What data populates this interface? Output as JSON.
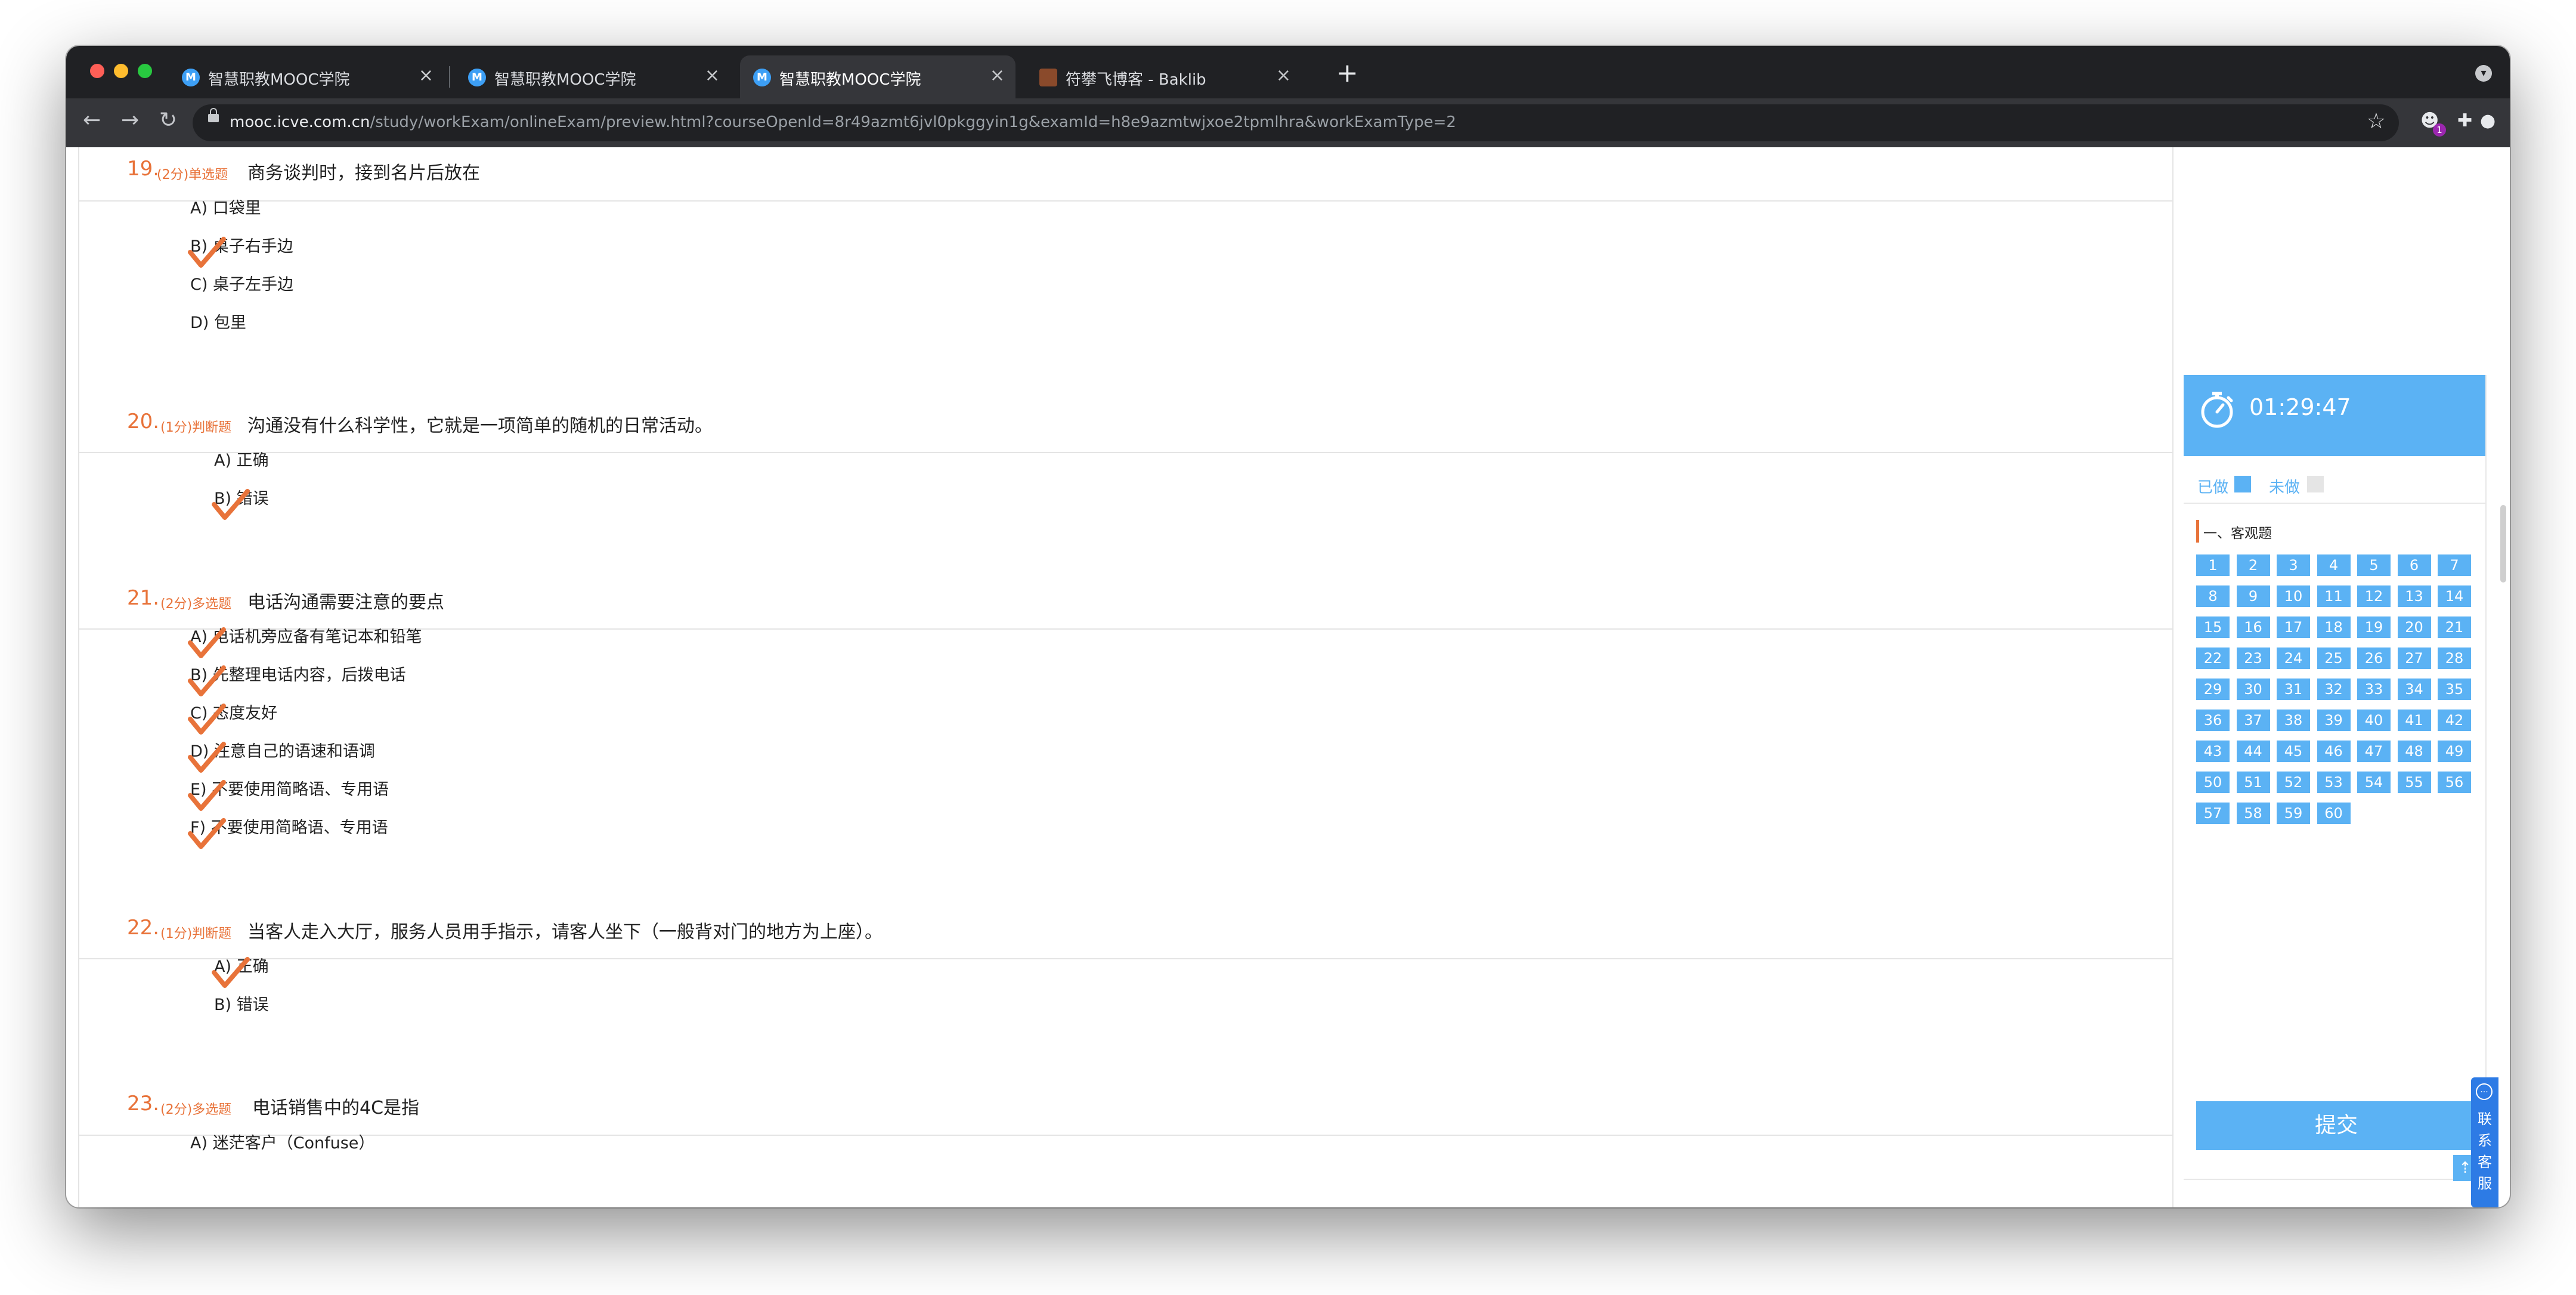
{
  "browser": {
    "tabs": [
      {
        "title": "智慧职教MOOC学院",
        "icon": "mooc-favicon-icon",
        "active": false
      },
      {
        "title": "智慧职教MOOC学院",
        "icon": "mooc-favicon-icon",
        "active": false
      },
      {
        "title": "智慧职教MOOC学院",
        "icon": "mooc-favicon-icon",
        "active": true
      },
      {
        "title": "符攀飞博客 - Baklib",
        "icon": "baklib-favicon-icon",
        "active": false
      }
    ],
    "favicon_letter": "M",
    "close_glyph": "×",
    "new_tab_glyph": "+",
    "url_host": "mooc.icve.com.cn",
    "url_path": "/study/workExam/onlineExam/preview.html?courseOpenId=8r49azmt6jvl0pkggyin1g&examId=h8e9azmtwjxoe2tpmlhra&workExamType=2",
    "extension_badge": "1"
  },
  "questions": [
    {
      "num": "19.",
      "score": "(2分)",
      "type": "单选题",
      "text": "商务谈判时，接到名片后放在",
      "options": [
        "A) 口袋里",
        "B) 桌子右手边",
        "C) 桌子左手边",
        "D) 包里"
      ],
      "checked": [
        1
      ]
    },
    {
      "num": "20.",
      "score": "(1分)",
      "type": "判断题",
      "text": "沟通没有什么科学性，它就是一项简单的随机的日常活动。",
      "options": [
        "A) 正确",
        "B) 错误"
      ],
      "checked": [
        1
      ]
    },
    {
      "num": "21.",
      "score": "(2分)",
      "type": "多选题",
      "text": "电话沟通需要注意的要点",
      "options": [
        "A) 电话机旁应备有笔记本和铅笔",
        "B) 先整理电话内容，后拨电话",
        "C) 态度友好",
        "D) 注意自己的语速和语调",
        "E) 不要使用简略语、专用语",
        "F) 不要使用简略语、专用语"
      ],
      "checked": [
        0,
        1,
        2,
        3,
        4,
        5
      ]
    },
    {
      "num": "22.",
      "score": "(1分)",
      "type": "判断题",
      "text": "当客人走入大厅，服务人员用手指示，请客人坐下（一般背对门的地方为上座）。",
      "options": [
        "A) 正确",
        "B) 错误"
      ],
      "checked": [
        0
      ]
    },
    {
      "num": "23.",
      "score": "(2分)",
      "type": "多选题",
      "text": "电话销售中的4C是指",
      "options": [
        "A) 迷茫客户（Confuse）"
      ],
      "checked": []
    }
  ],
  "sidebar": {
    "timer": "01:29:47",
    "legend_done": "已做",
    "legend_todo": "未做",
    "section_title": "一、客观题",
    "question_count": 60,
    "submit_label": "提交",
    "customer_service": "联系客服",
    "to_top": "⇡",
    "colors": {
      "accent": "#5bb2f4",
      "orange": "#e8733a",
      "service": "#2d7be5"
    }
  }
}
